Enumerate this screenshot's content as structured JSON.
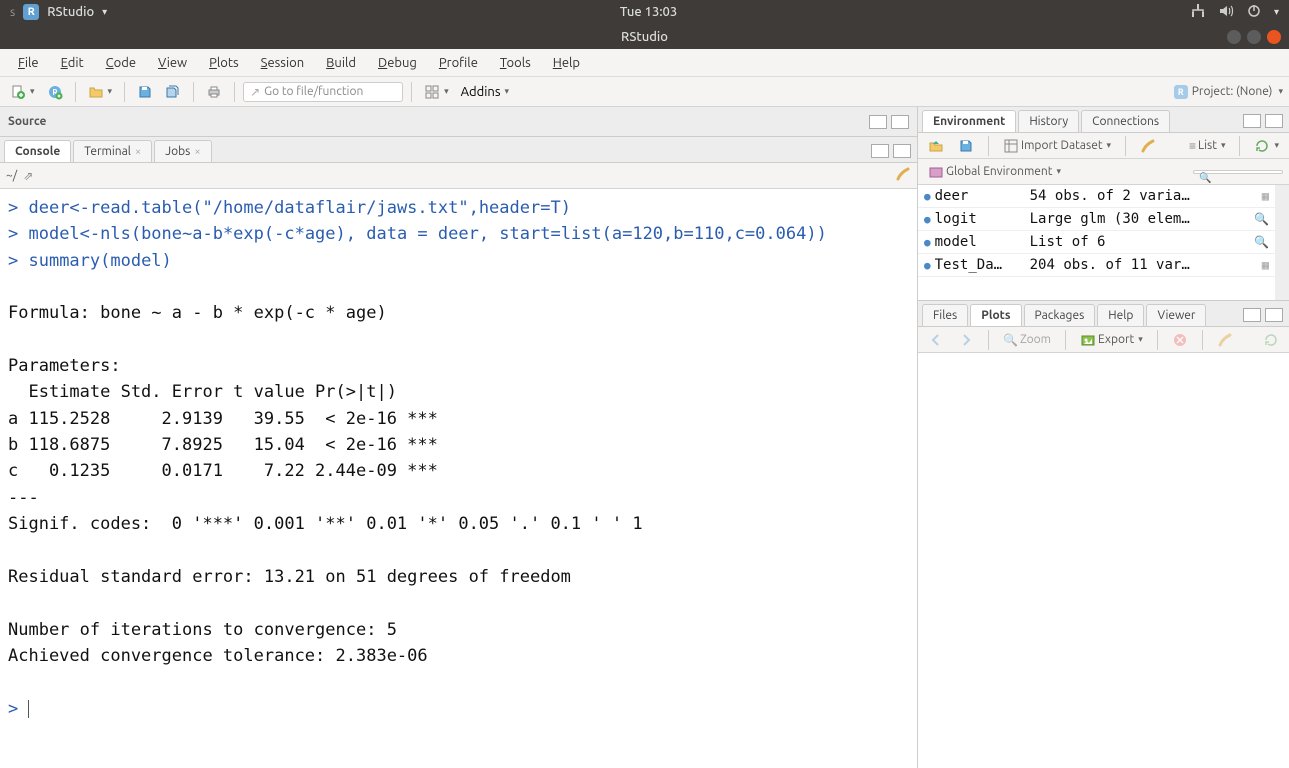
{
  "system": {
    "app_name": "RStudio",
    "clock": "Tue 13:03"
  },
  "window": {
    "title": "RStudio"
  },
  "menu": {
    "file": "File",
    "edit": "Edit",
    "code": "Code",
    "view": "View",
    "plots": "Plots",
    "session": "Session",
    "build": "Build",
    "debug": "Debug",
    "profile": "Profile",
    "tools": "Tools",
    "help": "Help"
  },
  "toolbar": {
    "goto_placeholder": "Go to file/function",
    "addins": "Addins",
    "project_label": "Project: (None)"
  },
  "source": {
    "header": "Source"
  },
  "console": {
    "tabs": {
      "console": "Console",
      "terminal": "Terminal",
      "jobs": "Jobs"
    },
    "working_dir": "~/",
    "lines": [
      "> deer<-read.table(\"/home/dataflair/jaws.txt\",header=T)",
      "> model<-nls(bone~a-b*exp(-c*age), data = deer, start=list(a=120,b=110,c=0.064))",
      "> summary(model)",
      "",
      "Formula: bone ~ a - b * exp(-c * age)",
      "",
      "Parameters:",
      "  Estimate Std. Error t value Pr(>|t|)    ",
      "a 115.2528     2.9139   39.55  < 2e-16 ***",
      "b 118.6875     7.8925   15.04  < 2e-16 ***",
      "c   0.1235     0.0171    7.22 2.44e-09 ***",
      "---",
      "Signif. codes:  0 '***' 0.001 '**' 0.01 '*' 0.05 '.' 0.1 ' ' 1",
      "",
      "Residual standard error: 13.21 on 51 degrees of freedom",
      "",
      "Number of iterations to convergence: 5 ",
      "Achieved convergence tolerance: 2.383e-06",
      "",
      "> "
    ]
  },
  "env_pane": {
    "tabs": {
      "environment": "Environment",
      "history": "History",
      "connections": "Connections"
    },
    "import_label": "Import Dataset",
    "list_label": "List",
    "scope": "Global Environment",
    "rows": [
      {
        "name": "deer",
        "value": "54 obs. of 2 varia…",
        "icon": "grid"
      },
      {
        "name": "logit",
        "value": "Large glm (30 elem…",
        "icon": "search"
      },
      {
        "name": "model",
        "value": "List of 6",
        "icon": "search"
      },
      {
        "name": "Test_Da…",
        "value": "204 obs. of 11 var…",
        "icon": "grid"
      }
    ]
  },
  "plot_pane": {
    "tabs": {
      "files": "Files",
      "plots": "Plots",
      "packages": "Packages",
      "help": "Help",
      "viewer": "Viewer"
    },
    "zoom": "Zoom",
    "export": "Export"
  }
}
